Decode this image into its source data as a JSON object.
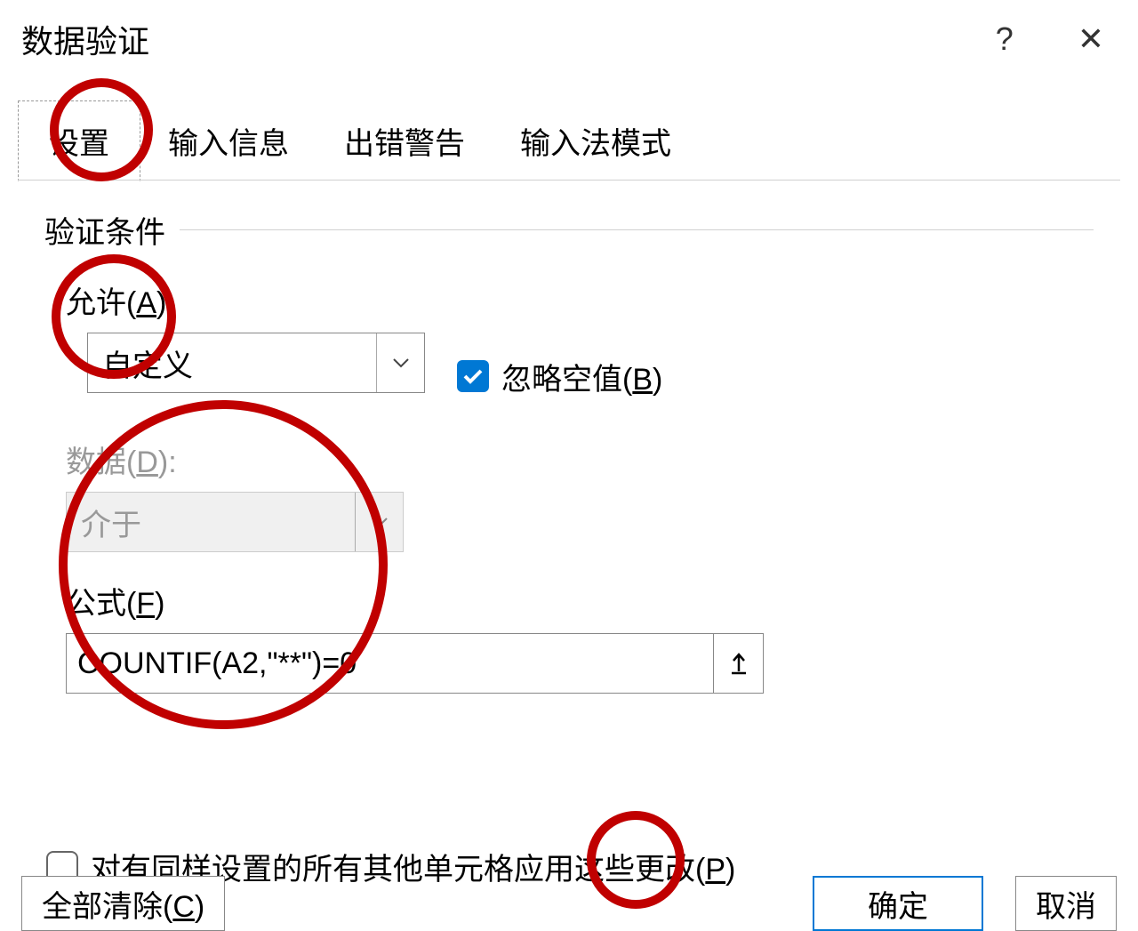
{
  "dialog": {
    "title": "数据验证",
    "help": "?",
    "close": "✕"
  },
  "tabs": {
    "settings": "设置",
    "input_message": "输入信息",
    "error_alert": "出错警告",
    "ime_mode": "输入法模式"
  },
  "section": {
    "criteria_label": "验证条件"
  },
  "fields": {
    "allow_label": "允许(A):",
    "allow_value": "自定义",
    "ignore_blank_label": "忽略空值(B)",
    "data_label": "数据(D):",
    "data_value": "介于",
    "formula_label": "公式(F)",
    "formula_value": "COUNTIF(A2,\"**\")=0",
    "apply_all_label": "对有同样设置的所有其他单元格应用这些更改(P)"
  },
  "footer": {
    "clear_all": "全部清除(C)",
    "ok": "确定",
    "cancel": "取消"
  }
}
